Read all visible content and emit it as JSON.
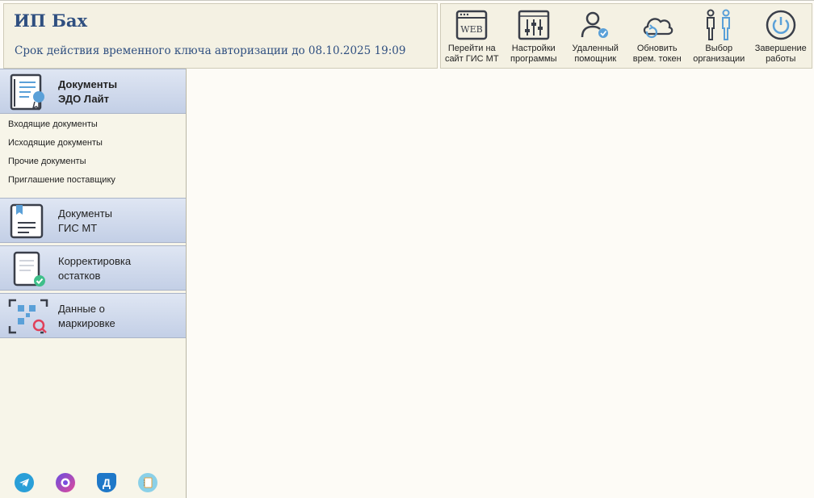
{
  "header": {
    "org_name": "ИП Бах",
    "token_text": "Срок действия временного ключа авторизации до 08.10.2025 19:09"
  },
  "toolbar": {
    "items": [
      {
        "label": "Перейти на\nсайт ГИС МТ",
        "icon": "web-icon"
      },
      {
        "label": "Настройки\nпрограммы",
        "icon": "settings-sliders-icon"
      },
      {
        "label": "Удаленный\nпомощник",
        "icon": "user-check-icon"
      },
      {
        "label": "Обновить\nврем. токен",
        "icon": "cloud-refresh-icon"
      },
      {
        "label": "Выбор\nорганизации",
        "icon": "people-icon"
      },
      {
        "label": "Завершение\nработы",
        "icon": "power-icon"
      }
    ],
    "web_glyph": "WEB"
  },
  "sidebar": {
    "sections": [
      {
        "title": "Документы\nЭДО Лайт",
        "active": true,
        "items": [
          "Входящие документы",
          "Исходящие документы",
          "Прочие документы",
          "Приглашение поставщику"
        ]
      },
      {
        "title": "Документы\nГИС МТ",
        "active": false
      },
      {
        "title": "Корректировка\nостатков",
        "active": false
      },
      {
        "title": "Данные о\nмаркировке",
        "active": false
      }
    ],
    "socials": [
      "telegram-icon",
      "chat-icon",
      "d-icon",
      "notebook-icon"
    ],
    "d_glyph": "Д"
  },
  "colors": {
    "accent": "#2f4f80",
    "icon_blue": "#5aa0d8",
    "icon_dark": "#3a3f4a",
    "check_green": "#3fbf8a"
  }
}
